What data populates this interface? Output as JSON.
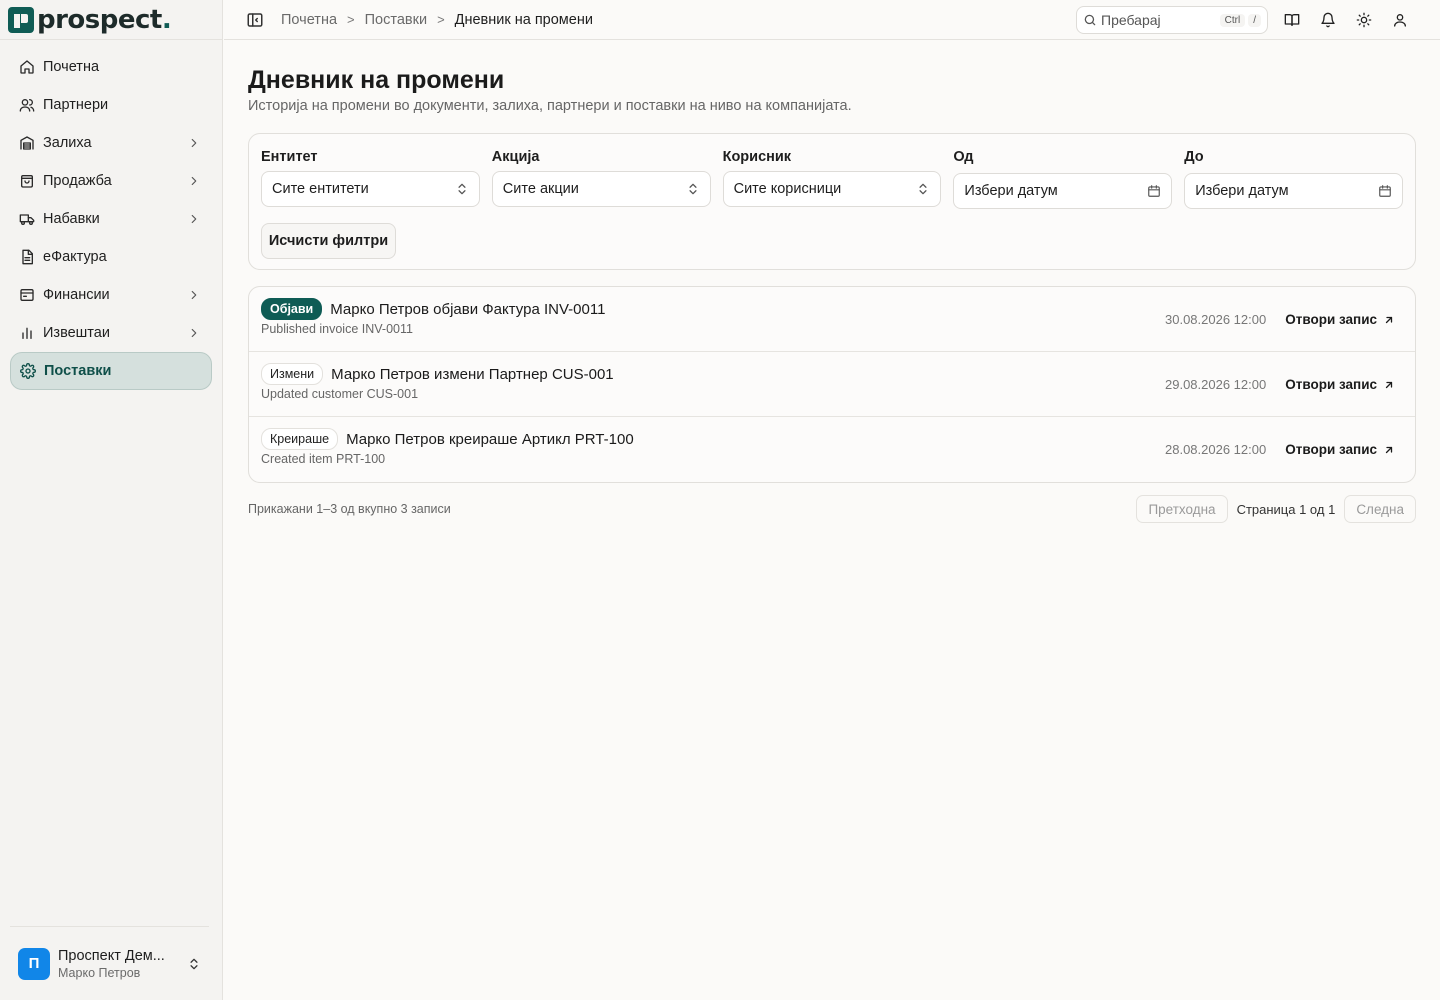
{
  "brand": {
    "name": "prospect",
    "dot": "."
  },
  "sidebar": {
    "items": [
      {
        "label": "Почетна",
        "icon": "home-icon",
        "chevron": false,
        "active": false
      },
      {
        "label": "Партнери",
        "icon": "users-icon",
        "chevron": false,
        "active": false
      },
      {
        "label": "Залиха",
        "icon": "warehouse-icon",
        "chevron": true,
        "active": false
      },
      {
        "label": "Продажба",
        "icon": "shopping-bag-icon",
        "chevron": true,
        "active": false
      },
      {
        "label": "Набавки",
        "icon": "truck-icon",
        "chevron": true,
        "active": false
      },
      {
        "label": "еФактура",
        "icon": "document-icon",
        "chevron": false,
        "active": false
      },
      {
        "label": "Финансии",
        "icon": "wallet-icon",
        "chevron": true,
        "active": false
      },
      {
        "label": "Извештаи",
        "icon": "bar-chart-icon",
        "chevron": true,
        "active": false
      },
      {
        "label": "Поставки",
        "icon": "gear-icon",
        "chevron": false,
        "active": true
      }
    ],
    "org": {
      "avatar": "П",
      "name": "Проспект Дем...",
      "user": "Марко Петров"
    }
  },
  "topbar": {
    "breadcrumb": [
      "Почетна",
      "Поставки",
      "Дневник на промени"
    ],
    "search_placeholder": "Пребарај",
    "kbd_ctrl": "Ctrl",
    "kbd_slash": "/"
  },
  "page": {
    "title": "Дневник на промени",
    "subtitle": "Историја на промени во документи, залиха, партнери и поставки на ниво на компанијата."
  },
  "filters": {
    "entity": {
      "label": "Ентитет",
      "value": "Сите ентитети"
    },
    "action": {
      "label": "Акција",
      "value": "Сите акции"
    },
    "user": {
      "label": "Корисник",
      "value": "Сите корисници"
    },
    "from": {
      "label": "Од",
      "value": "Избери датум"
    },
    "to": {
      "label": "До",
      "value": "Избери датум"
    },
    "clear_label": "Исчисти филтри"
  },
  "log": {
    "rows": [
      {
        "badge": "Објави",
        "badge_style": "primary",
        "title": "Марко Петров објави Фактура INV-0011",
        "desc": "Published invoice INV-0011",
        "time": "30.08.2026 12:00",
        "link": "Отвори запис"
      },
      {
        "badge": "Измени",
        "badge_style": "outline",
        "title": "Марко Петров измени Партнер CUS-001",
        "desc": "Updated customer CUS-001",
        "time": "29.08.2026 12:00",
        "link": "Отвори запис"
      },
      {
        "badge": "Креираше",
        "badge_style": "outline",
        "title": "Марко Петров креираше Артикл PRT-100",
        "desc": "Created item PRT-100",
        "time": "28.08.2026 12:00",
        "link": "Отвори запис"
      }
    ]
  },
  "pagination": {
    "summary": "Прикажани 1–3 од вкупно 3 записи",
    "prev": "Претходна",
    "info": "Страница 1 од 1",
    "next": "Следна"
  },
  "colors": {
    "accent": "#0f5c55",
    "active_bg": "#d5e0dd",
    "avatar": "#1186e8"
  }
}
